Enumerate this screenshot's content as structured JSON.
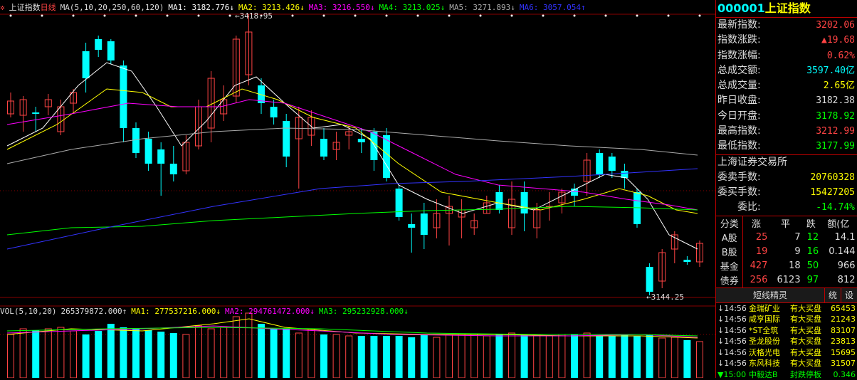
{
  "header": {
    "title": "上证指数",
    "period": "日线",
    "ma_label": "MA(5,10,20,250,60,120)",
    "ma_values": [
      {
        "label": "MA1: 3182.776↓",
        "color": "#ffffff"
      },
      {
        "label": "MA2: 3213.426↓",
        "color": "#ffff00"
      },
      {
        "label": "MA3: 3216.550↓",
        "color": "#ff00ff"
      },
      {
        "label": "MA4: 3213.025↓",
        "color": "#00ff00"
      },
      {
        "label": "MA5: 3271.893↓",
        "color": "#aaaaaa"
      },
      {
        "label": "MA6: 3057.054↑",
        "color": "#3333ff"
      }
    ]
  },
  "annotations": {
    "high": "3418.95",
    "low": "3144.25"
  },
  "vol_header": {
    "label": "VOL(5,10,20)",
    "value": "265379872.000↑",
    "ma": [
      {
        "label": "MA1: 277537216.000↓",
        "color": "#ffff00"
      },
      {
        "label": "MA2: 294761472.000↓",
        "color": "#ff00ff"
      },
      {
        "label": "MA3: 295232928.000↓",
        "color": "#00ff00"
      }
    ]
  },
  "panel": {
    "code": "000001",
    "name": "上证指数",
    "stats": [
      {
        "label": "最新指数:",
        "value": "3202.06",
        "color": "#ff4444"
      },
      {
        "label": "指数涨跌:",
        "value": "▲19.68",
        "color": "#ff4444"
      },
      {
        "label": "指数涨幅:",
        "value": "0.62%",
        "color": "#ff4444"
      },
      {
        "label": "总成交额:",
        "value": "3597.40亿",
        "color": "#00ffff"
      },
      {
        "label": "总成交量:",
        "value": "2.65亿",
        "color": "#ffff00"
      },
      {
        "label": "昨日收盘:",
        "value": "3182.38",
        "color": "#dddddd"
      },
      {
        "label": "今日开盘:",
        "value": "3178.92",
        "color": "#00ff00"
      },
      {
        "label": "最高指数:",
        "value": "3212.99",
        "color": "#ff4444"
      },
      {
        "label": "最低指数:",
        "value": "3177.99",
        "color": "#00ff00"
      }
    ],
    "exchange_title": "上海证券交易所",
    "exchange": [
      {
        "label": "委卖手数:",
        "value": "20760328",
        "color": "#ffff00"
      },
      {
        "label": "委买手数:",
        "value": "15427205",
        "color": "#ffff00"
      },
      {
        "label": "委比:",
        "value": "-14.74%",
        "color": "#00ff00"
      }
    ],
    "class_head": [
      "分类",
      "涨",
      "平",
      "跌",
      "额(亿"
    ],
    "classes": [
      {
        "name": "A股",
        "up": "25",
        "flat": "7",
        "down": "12",
        "amt": "14.1"
      },
      {
        "name": "B股",
        "up": "19",
        "flat": "9",
        "down": "16",
        "amt": "0.144"
      },
      {
        "name": "基金",
        "up": "427",
        "flat": "18",
        "down": "50",
        "amt": "966"
      },
      {
        "name": "债券",
        "up": "256",
        "flat": "6123",
        "down": "97",
        "amt": "812"
      }
    ],
    "spirit_tabs": [
      "短线精灵",
      "统",
      "设"
    ],
    "news": [
      {
        "time": "↓14:56",
        "name": "金瑞矿业",
        "action": "有大买盘",
        "value": "65453"
      },
      {
        "time": "↓14:56",
        "name": "咸亨国际",
        "action": "有大买盘",
        "value": "21243"
      },
      {
        "time": "↓14:56",
        "name": "*ST全筑",
        "action": "有大买盘",
        "value": "83107"
      },
      {
        "time": "↓14:56",
        "name": "圣龙股份",
        "action": "有大买盘",
        "value": "23813"
      },
      {
        "time": "↓14:56",
        "name": "沃格光电",
        "action": "有大买盘",
        "value": "15695"
      },
      {
        "time": "↓14:56",
        "name": "东风科技",
        "action": "有大买盘",
        "value": "31507"
      },
      {
        "time": "▼15:00",
        "name": "中毅达B",
        "action": "封跌停板",
        "value": "0.346"
      }
    ]
  },
  "colors": {
    "up": "#ff4444",
    "down": "#00ffff",
    "ma1": "#ffffff",
    "ma2": "#ffff00",
    "ma3": "#ff00ff",
    "ma4": "#00ff00",
    "ma5": "#aaaaaa",
    "ma6": "#3333ff",
    "grid": "#880000"
  }
}
